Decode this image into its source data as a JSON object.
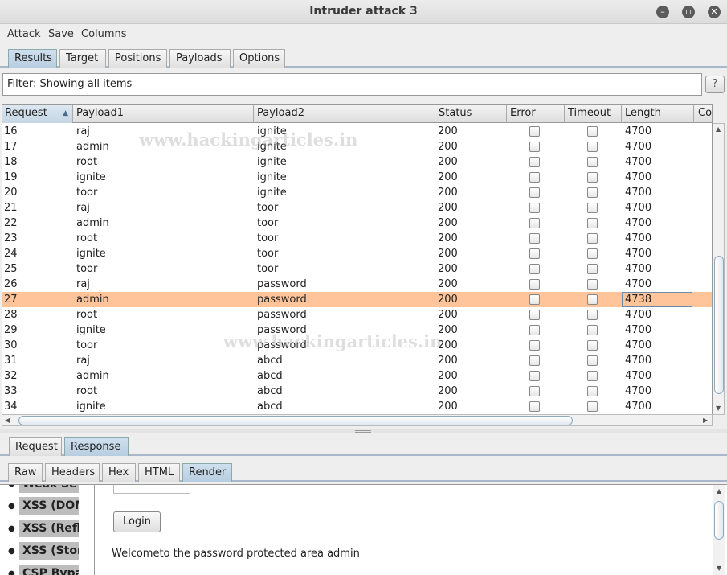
{
  "window": {
    "title": "Intruder attack 3"
  },
  "menu": {
    "items": [
      "Attack",
      "Save",
      "Columns"
    ]
  },
  "main_tabs": [
    {
      "label": "Results",
      "active": true
    },
    {
      "label": "Target",
      "active": false
    },
    {
      "label": "Positions",
      "active": false
    },
    {
      "label": "Payloads",
      "active": false
    },
    {
      "label": "Options",
      "active": false
    }
  ],
  "filter": {
    "text": "Filter: Showing all items",
    "help": "?"
  },
  "table": {
    "columns": [
      "Request",
      "Payload1",
      "Payload2",
      "Status",
      "Error",
      "Timeout",
      "Length",
      "Cor"
    ],
    "sorted_column": "Request",
    "rows": [
      [
        "16",
        "raj",
        "ignite",
        "200",
        "4700"
      ],
      [
        "17",
        "admin",
        "ignite",
        "200",
        "4700"
      ],
      [
        "18",
        "root",
        "ignite",
        "200",
        "4700"
      ],
      [
        "19",
        "ignite",
        "ignite",
        "200",
        "4700"
      ],
      [
        "20",
        "toor",
        "ignite",
        "200",
        "4700"
      ],
      [
        "21",
        "raj",
        "toor",
        "200",
        "4700"
      ],
      [
        "22",
        "admin",
        "toor",
        "200",
        "4700"
      ],
      [
        "23",
        "root",
        "toor",
        "200",
        "4700"
      ],
      [
        "24",
        "ignite",
        "toor",
        "200",
        "4700"
      ],
      [
        "25",
        "toor",
        "toor",
        "200",
        "4700"
      ],
      [
        "26",
        "raj",
        "password",
        "200",
        "4700"
      ],
      [
        "27",
        "admin",
        "password",
        "200",
        "4738"
      ],
      [
        "28",
        "root",
        "password",
        "200",
        "4700"
      ],
      [
        "29",
        "ignite",
        "password",
        "200",
        "4700"
      ],
      [
        "30",
        "toor",
        "password",
        "200",
        "4700"
      ],
      [
        "31",
        "raj",
        "abcd",
        "200",
        "4700"
      ],
      [
        "32",
        "admin",
        "abcd",
        "200",
        "4700"
      ],
      [
        "33",
        "root",
        "abcd",
        "200",
        "4700"
      ],
      [
        "34",
        "ignite",
        "abcd",
        "200",
        "4700"
      ]
    ],
    "selected_request": "27",
    "selected_color": "#ffc49a"
  },
  "watermark": "www.hackingarticles.in",
  "req_res_tabs": [
    {
      "label": "Request",
      "active": false
    },
    {
      "label": "Response",
      "active": true
    }
  ],
  "view_tabs": [
    {
      "label": "Raw",
      "active": false
    },
    {
      "label": "Headers",
      "active": false
    },
    {
      "label": "Hex",
      "active": false
    },
    {
      "label": "HTML",
      "active": false
    },
    {
      "label": "Render",
      "active": true
    }
  ],
  "render": {
    "sidebar_items": [
      "Weak Se",
      "XSS (DOM",
      "XSS (Refl",
      "XSS (Stor",
      "CSP Bypa"
    ],
    "login_button": "Login",
    "welcome_text": "Welcometo the password protected area admin"
  }
}
